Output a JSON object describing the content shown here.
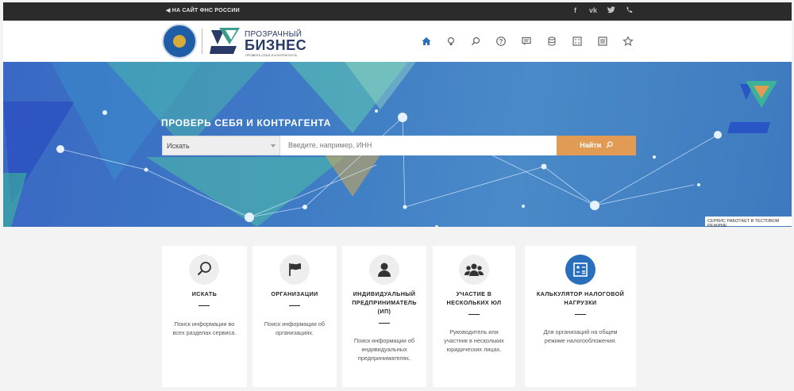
{
  "topbar": {
    "back_link": "НА САЙТ ФНС РОССИИ",
    "social": [
      "f",
      "vk",
      "twitter",
      "phone"
    ]
  },
  "header": {
    "brand_line1": "ПРОЗРАЧНЫЙ",
    "brand_line2": "БИЗНЕС",
    "brand_line3": "ПРОВЕРЬ СЕБЯ И КОНТРАГЕНТА",
    "nav_icons": [
      "home-icon",
      "lightbulb-icon",
      "search-icon",
      "help-icon",
      "chat-icon",
      "database-icon",
      "calculator-icon",
      "list-icon",
      "star-icon"
    ],
    "accent_color": "#2a6fbb"
  },
  "hero": {
    "title": "ПРОВЕРЬ СЕБЯ И КОНТРАГЕНТА",
    "select_value": "Искать",
    "input_placeholder": "Введите, например, ИНН",
    "search_button": "Найти",
    "test_mode_badge": "СЕРВИС РАБОТАЕТ В ТЕСТОВОМ РЕЖИМЕ",
    "button_color": "#e29b54"
  },
  "cards": [
    {
      "icon": "search-icon",
      "title": [
        "ИСКАТЬ"
      ],
      "desc": [
        "Поиск информации во",
        "всех разделах сервиса."
      ]
    },
    {
      "icon": "flag-icon",
      "title": [
        "ОРГАНИЗАЦИИ"
      ],
      "desc": [
        "Поиск информации об",
        "организациях."
      ]
    },
    {
      "icon": "user-icon",
      "title": [
        "ИНДИВИДУАЛЬНЫЙ",
        "ПРЕДПРИНИМАТЕЛЬ",
        "(ИП)"
      ],
      "desc": [
        "Поиск информации об",
        "индивидуальных",
        "предпринимателях."
      ]
    },
    {
      "icon": "group-icon",
      "title": [
        "УЧАСТИЕ В",
        "НЕСКОЛЬКИХ ЮЛ"
      ],
      "desc": [
        "Руководитель или",
        "участник в нескольких",
        "юридических лицах."
      ]
    },
    {
      "icon": "calculator-icon",
      "title": [
        "КАЛЬКУЛЯТОР НАЛОГОВОЙ",
        "НАГРУЗКИ"
      ],
      "desc": [
        "Для организаций на общем",
        "режиме налогообложения."
      ]
    }
  ]
}
